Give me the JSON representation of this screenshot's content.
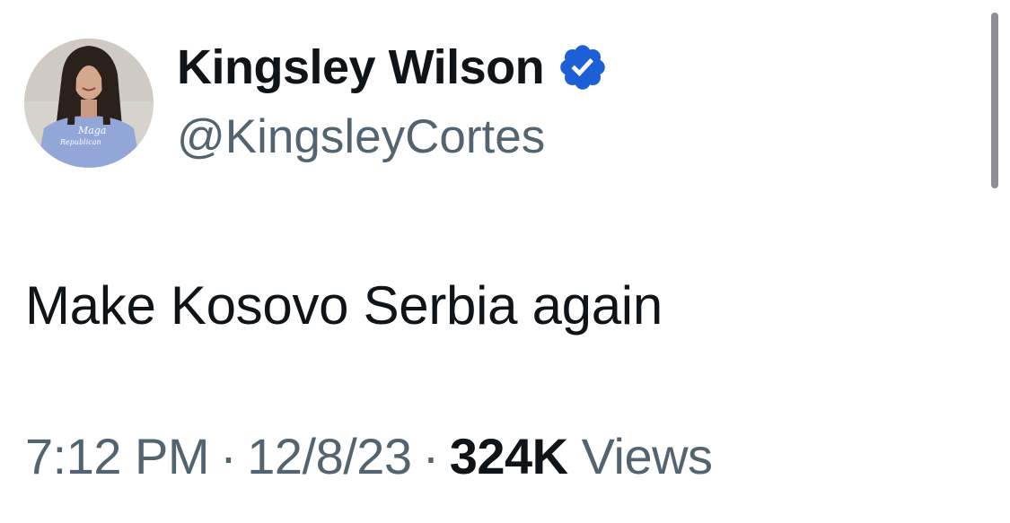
{
  "author": {
    "display_name": "Kingsley Wilson",
    "handle": "@KingsleyCortes",
    "verified": true,
    "verified_icon": "verified-badge-icon",
    "avatar_shirt_text_line1": "Maga",
    "avatar_shirt_text_line2": "Republican"
  },
  "tweet": {
    "text": "Make Kosovo Serbia again"
  },
  "meta": {
    "time": "7:12 PM",
    "separator": "·",
    "date": "12/8/23",
    "views_count": "324K",
    "views_label": "Views"
  },
  "colors": {
    "primary_text": "#0f1419",
    "secondary_text": "#536471",
    "verified_blue": "#1d5fd6",
    "background": "#ffffff"
  }
}
